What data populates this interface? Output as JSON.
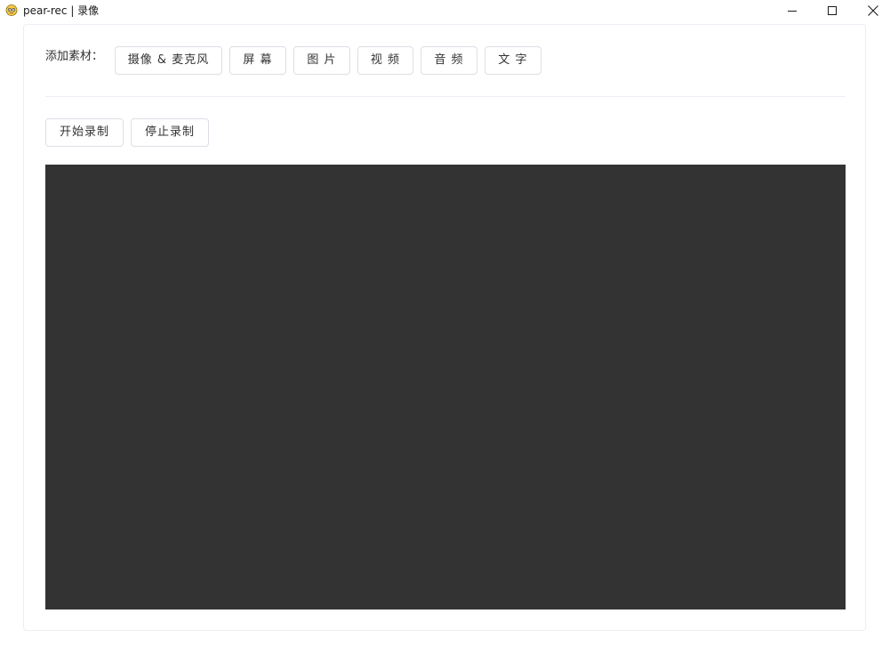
{
  "window": {
    "title": "pear-rec | 录像",
    "icon": "pear-rec-logo-icon",
    "controls": {
      "minimize_icon": "minimize-icon",
      "maximize_icon": "maximize-icon",
      "close_icon": "close-icon"
    }
  },
  "materials": {
    "label": "添加素材：",
    "buttons": [
      {
        "label": "摄像 & 麦克风"
      },
      {
        "label": "屏 幕"
      },
      {
        "label": "图 片"
      },
      {
        "label": "视 频"
      },
      {
        "label": "音 频"
      },
      {
        "label": "文 字"
      }
    ]
  },
  "recording": {
    "start_label": "开始录制",
    "stop_label": "停止录制"
  },
  "preview": {
    "background": "#333333"
  }
}
